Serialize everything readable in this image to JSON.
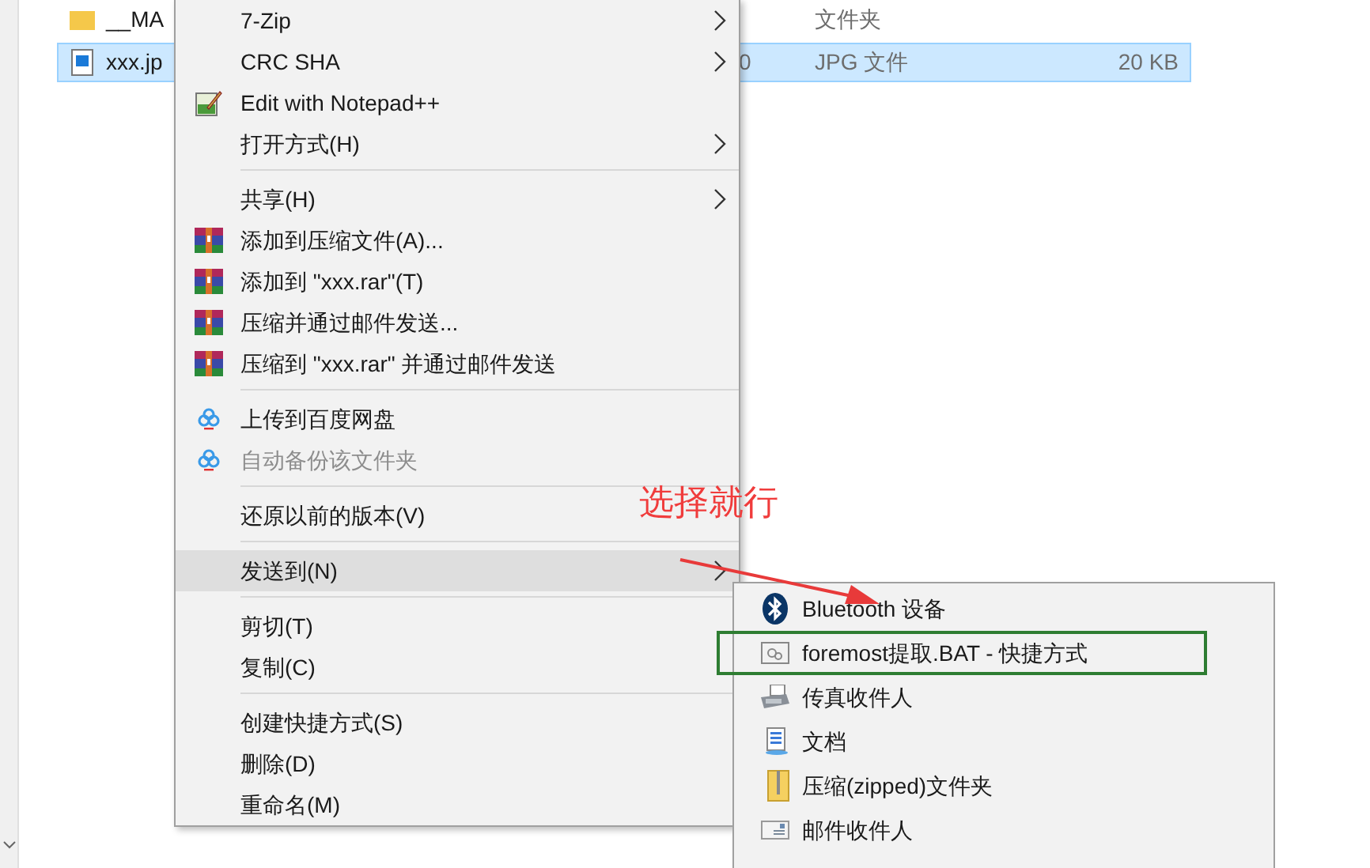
{
  "files": [
    {
      "kind": "folder",
      "name": "__MA",
      "type": "文件夹",
      "selected": false
    },
    {
      "kind": "image",
      "name": "xxx.jp",
      "date": "0",
      "type": "JPG 文件",
      "size": "20 KB",
      "selected": true
    }
  ],
  "context_menu": {
    "groups": [
      [
        {
          "kind": "plain",
          "label": "7-Zip",
          "submenu": true,
          "selected": false,
          "disabled": false
        },
        {
          "kind": "plain",
          "label": "CRC SHA",
          "submenu": true,
          "selected": false,
          "disabled": false
        },
        {
          "kind": "notepad",
          "label": "Edit with Notepad++",
          "submenu": false,
          "selected": false,
          "disabled": false
        },
        {
          "kind": "plain",
          "label": "打开方式(H)",
          "submenu": true,
          "selected": false,
          "disabled": false
        }
      ],
      [
        {
          "kind": "plain",
          "label": "共享(H)",
          "submenu": true,
          "selected": false,
          "disabled": false
        },
        {
          "kind": "archive",
          "label": "添加到压缩文件(A)...",
          "submenu": false,
          "selected": false,
          "disabled": false
        },
        {
          "kind": "archive",
          "label": "添加到 \"xxx.rar\"(T)",
          "submenu": false,
          "selected": false,
          "disabled": false
        },
        {
          "kind": "archive",
          "label": "压缩并通过邮件发送...",
          "submenu": false,
          "selected": false,
          "disabled": false
        },
        {
          "kind": "archive",
          "label": "压缩到 \"xxx.rar\" 并通过邮件发送",
          "submenu": false,
          "selected": false,
          "disabled": false
        }
      ],
      [
        {
          "kind": "cloud",
          "label": "上传到百度网盘",
          "submenu": false,
          "selected": false,
          "disabled": false
        },
        {
          "kind": "cloud",
          "label": "自动备份该文件夹",
          "submenu": false,
          "selected": false,
          "disabled": true
        }
      ],
      [
        {
          "kind": "plain",
          "label": "还原以前的版本(V)",
          "submenu": false,
          "selected": false,
          "disabled": false
        }
      ],
      [
        {
          "kind": "plain",
          "label": "发送到(N)",
          "submenu": true,
          "selected": true,
          "disabled": false
        }
      ],
      [
        {
          "kind": "plain",
          "label": "剪切(T)",
          "submenu": false,
          "selected": false,
          "disabled": false
        },
        {
          "kind": "plain",
          "label": "复制(C)",
          "submenu": false,
          "selected": false,
          "disabled": false
        }
      ],
      [
        {
          "kind": "plain",
          "label": "创建快捷方式(S)",
          "submenu": false,
          "selected": false,
          "disabled": false
        },
        {
          "kind": "plain",
          "label": "删除(D)",
          "submenu": false,
          "selected": false,
          "disabled": false
        },
        {
          "kind": "plain",
          "label": "重命名(M)",
          "submenu": false,
          "selected": false,
          "disabled": false
        }
      ]
    ]
  },
  "send_to_menu": {
    "items": [
      {
        "kind": "bluetooth",
        "label": "Bluetooth 设备",
        "highlighted": false
      },
      {
        "kind": "batch",
        "label": "foremost提取.BAT - 快捷方式",
        "highlighted": true
      },
      {
        "kind": "fax",
        "label": "传真收件人",
        "highlighted": false
      },
      {
        "kind": "document",
        "label": "文档",
        "highlighted": false
      },
      {
        "kind": "zip",
        "label": "压缩(zipped)文件夹",
        "highlighted": false
      },
      {
        "kind": "mail",
        "label": "邮件收件人",
        "highlighted": false
      }
    ]
  },
  "annotation": {
    "text": "选择就行"
  }
}
